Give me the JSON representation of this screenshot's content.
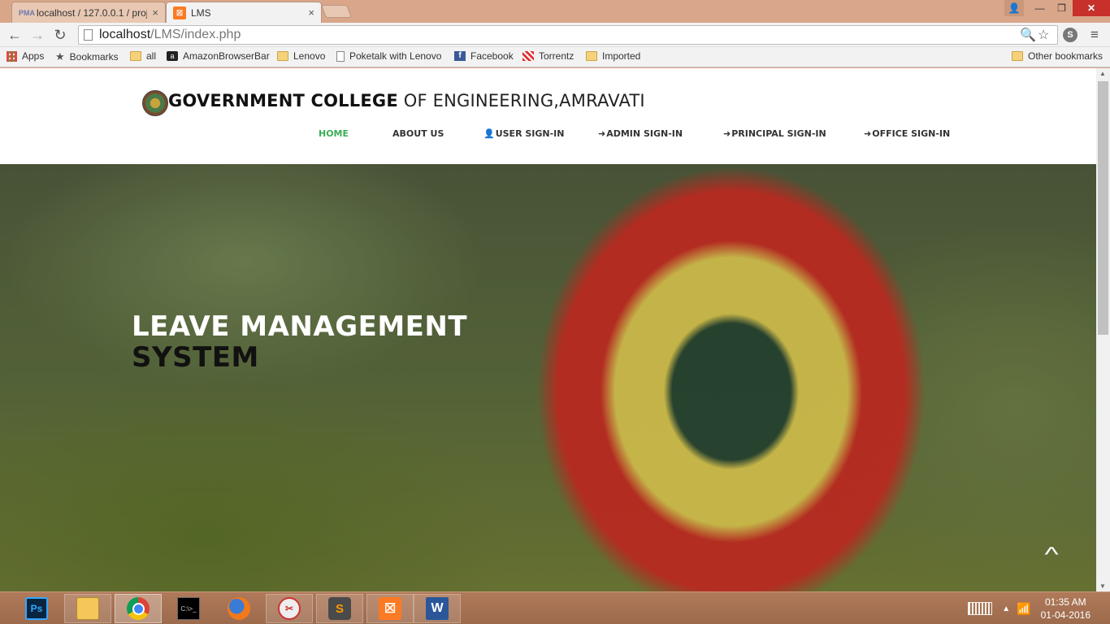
{
  "browser": {
    "tabs": [
      {
        "title": "localhost / 127.0.0.1 / proj",
        "favicon": "phpmyadmin-icon",
        "favicon_text": "PMA",
        "active": false
      },
      {
        "title": "LMS",
        "favicon": "xampp-icon",
        "favicon_text": "☒",
        "active": true
      }
    ],
    "close_glyph": "×",
    "window_buttons": {
      "minimize": "—",
      "maximize": "❐",
      "close": "✕",
      "user": "👤"
    },
    "nav": {
      "back": "←",
      "forward": "→",
      "reload": "↻"
    },
    "address": {
      "host": "localhost",
      "path": "/LMS/index.php"
    },
    "omnibox_icons": {
      "search": "🔍",
      "star": "☆"
    },
    "extensions": {
      "skype": "S"
    },
    "menu": "≡",
    "bookmarks": [
      {
        "label": "Apps",
        "icon": "apps-icon"
      },
      {
        "label": "Bookmarks",
        "icon": "star-icon"
      },
      {
        "label": "all",
        "icon": "folder-icon"
      },
      {
        "label": "AmazonBrowserBar",
        "icon": "amazon-icon"
      },
      {
        "label": "Lenovo",
        "icon": "folder-icon"
      },
      {
        "label": "Poketalk with Lenovo",
        "icon": "page-icon"
      },
      {
        "label": "Facebook",
        "icon": "facebook-icon"
      },
      {
        "label": "Torrentz",
        "icon": "torrentz-icon"
      },
      {
        "label": "Imported",
        "icon": "folder-icon"
      }
    ],
    "other_bookmarks": "Other bookmarks"
  },
  "site": {
    "title_bold": "GOVERNMENT COLLEGE",
    "title_rest": " OF ENGINEERING,AMRAVATI",
    "nav": [
      {
        "label": "HOME",
        "icon": "",
        "active": true
      },
      {
        "label": "ABOUT US",
        "icon": "",
        "active": false
      },
      {
        "label": "USER SIGN-IN",
        "icon": "user-icon",
        "glyph": "👤",
        "active": false
      },
      {
        "label": "ADMIN SIGN-IN",
        "icon": "sign-in-icon",
        "glyph": "➜",
        "active": false
      },
      {
        "label": "PRINCIPAL SIGN-IN",
        "icon": "sign-in-icon",
        "glyph": "➜",
        "active": false
      },
      {
        "label": "OFFICE SIGN-IN",
        "icon": "sign-in-icon",
        "glyph": "➜",
        "active": false
      }
    ],
    "accent_color": "#3aae57",
    "hero": {
      "line1": "LEAVE MANAGEMENT",
      "line2": "SYSTEM",
      "to_top": "^"
    }
  },
  "taskbar": {
    "apps": [
      {
        "name": "photoshop-icon",
        "text": "Ps"
      },
      {
        "name": "file-explorer-icon",
        "text": ""
      },
      {
        "name": "chrome-icon",
        "text": ""
      },
      {
        "name": "command-prompt-icon",
        "text": "C:\\>_"
      },
      {
        "name": "firefox-icon",
        "text": ""
      },
      {
        "name": "snipping-tool-icon",
        "text": "✂"
      },
      {
        "name": "sublime-text-icon",
        "text": "S"
      },
      {
        "name": "xampp-icon",
        "text": "☒"
      },
      {
        "name": "word-icon",
        "text": "W"
      }
    ],
    "tray": {
      "show_hidden": "▲",
      "network": "📶"
    },
    "time": "01:35 AM",
    "date": "01-04-2016"
  }
}
